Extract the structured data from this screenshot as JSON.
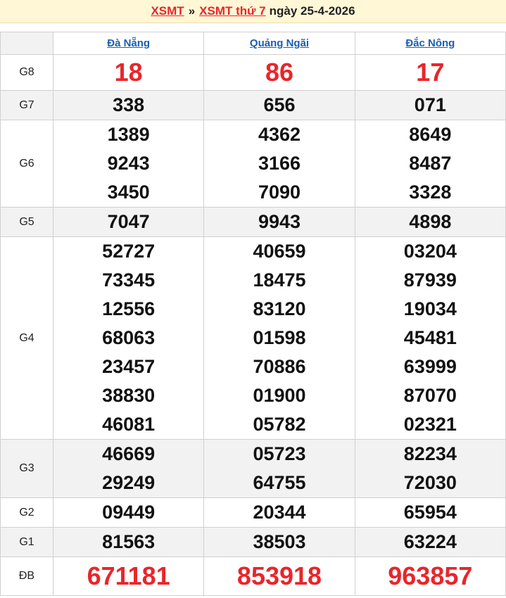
{
  "header": {
    "link1": "XSMT",
    "separator": "»",
    "link2": "XSMT thứ 7",
    "date_text": "ngày 25-4-2026"
  },
  "provinces": [
    "Đà Nẵng",
    "Quảng Ngãi",
    "Đắc Nông"
  ],
  "prizes": [
    {
      "label": "G8",
      "style": "red",
      "shade": false,
      "results": [
        [
          "18"
        ],
        [
          "86"
        ],
        [
          "17"
        ]
      ]
    },
    {
      "label": "G7",
      "style": "normal",
      "shade": true,
      "results": [
        [
          "338"
        ],
        [
          "656"
        ],
        [
          "071"
        ]
      ]
    },
    {
      "label": "G6",
      "style": "normal",
      "shade": false,
      "results": [
        [
          "1389",
          "9243",
          "3450"
        ],
        [
          "4362",
          "3166",
          "7090"
        ],
        [
          "8649",
          "8487",
          "3328"
        ]
      ]
    },
    {
      "label": "G5",
      "style": "normal",
      "shade": true,
      "results": [
        [
          "7047"
        ],
        [
          "9943"
        ],
        [
          "4898"
        ]
      ]
    },
    {
      "label": "G4",
      "style": "normal",
      "shade": false,
      "results": [
        [
          "52727",
          "73345",
          "12556",
          "68063",
          "23457",
          "38830",
          "46081"
        ],
        [
          "40659",
          "18475",
          "83120",
          "01598",
          "70886",
          "01900",
          "05782"
        ],
        [
          "03204",
          "87939",
          "19034",
          "45481",
          "63999",
          "87070",
          "02321"
        ]
      ]
    },
    {
      "label": "G3",
      "style": "normal",
      "shade": true,
      "results": [
        [
          "46669",
          "29249"
        ],
        [
          "05723",
          "64755"
        ],
        [
          "82234",
          "72030"
        ]
      ]
    },
    {
      "label": "G2",
      "style": "normal",
      "shade": false,
      "results": [
        [
          "09449"
        ],
        [
          "20344"
        ],
        [
          "65954"
        ]
      ]
    },
    {
      "label": "G1",
      "style": "normal",
      "shade": true,
      "results": [
        [
          "81563"
        ],
        [
          "38503"
        ],
        [
          "63224"
        ]
      ]
    },
    {
      "label": "ĐB",
      "style": "db",
      "shade": false,
      "results": [
        [
          "671181"
        ],
        [
          "853918"
        ],
        [
          "963857"
        ]
      ]
    }
  ],
  "colors": {
    "accent_red": "#e8262b",
    "link_blue": "#1a5fb4",
    "header_bg": "#fff7d6",
    "row_shade": "#f2f2f2"
  }
}
